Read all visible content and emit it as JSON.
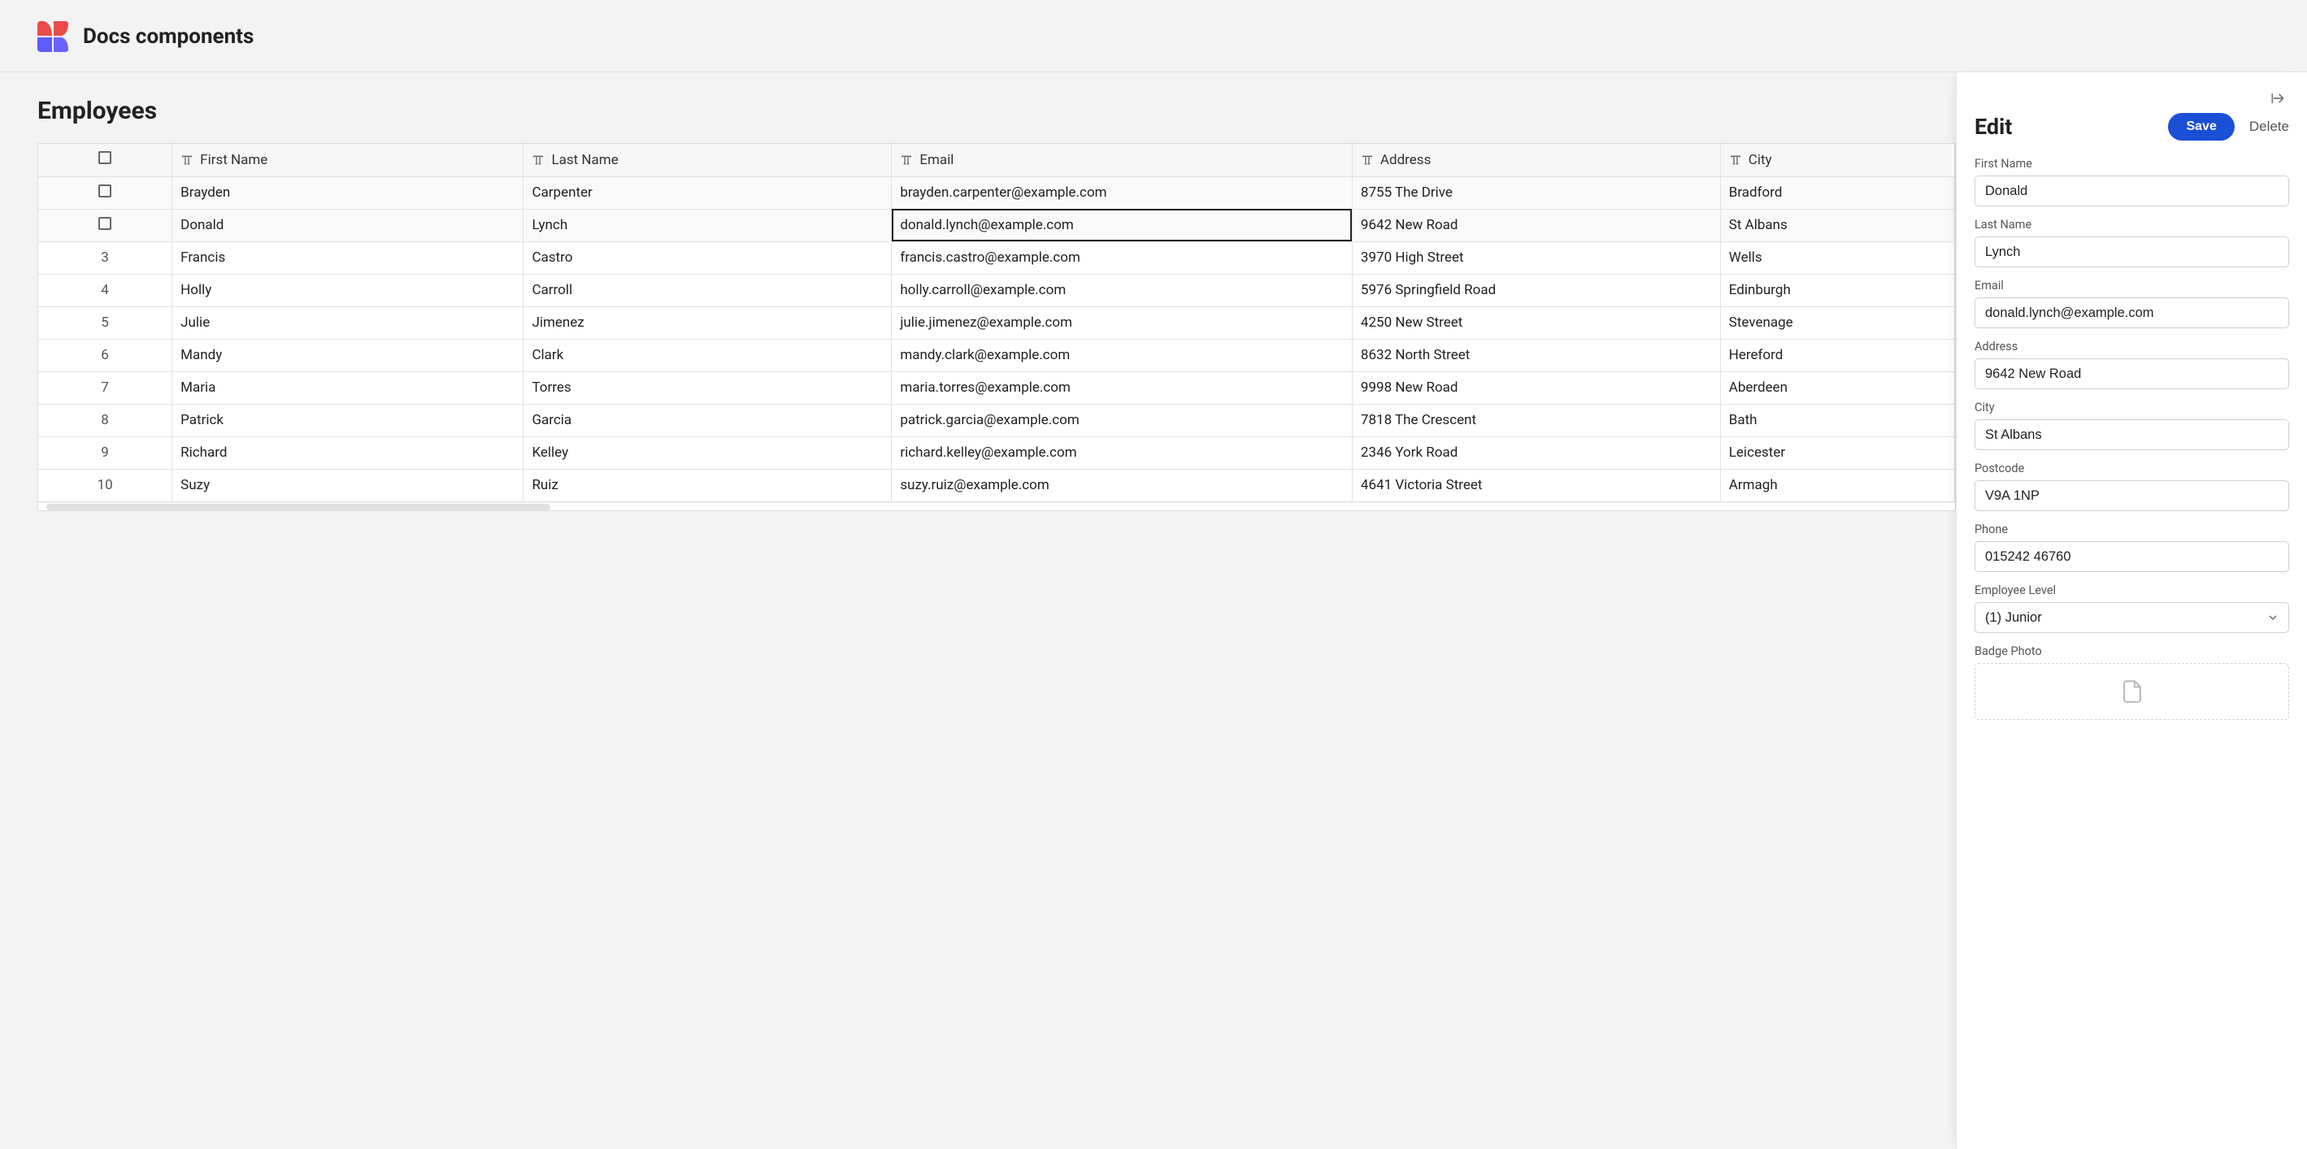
{
  "app": {
    "title": "Docs components"
  },
  "page": {
    "title": "Employees"
  },
  "grid": {
    "columns": [
      {
        "key": "first_name",
        "label": "First Name"
      },
      {
        "key": "last_name",
        "label": "Last Name"
      },
      {
        "key": "email",
        "label": "Email"
      },
      {
        "key": "address",
        "label": "Address"
      },
      {
        "key": "city",
        "label": "City"
      }
    ],
    "selected_rows": [
      0,
      1
    ],
    "focused_cell": {
      "row": 1,
      "col": "email"
    },
    "rows": [
      {
        "num": "",
        "first_name": "Brayden",
        "last_name": "Carpenter",
        "email": "brayden.carpenter@example.com",
        "address": "8755 The Drive",
        "city": "Bradford"
      },
      {
        "num": "",
        "first_name": "Donald",
        "last_name": "Lynch",
        "email": "donald.lynch@example.com",
        "address": "9642 New Road",
        "city": "St Albans"
      },
      {
        "num": "3",
        "first_name": "Francis",
        "last_name": "Castro",
        "email": "francis.castro@example.com",
        "address": "3970 High Street",
        "city": "Wells"
      },
      {
        "num": "4",
        "first_name": "Holly",
        "last_name": "Carroll",
        "email": "holly.carroll@example.com",
        "address": "5976 Springfield Road",
        "city": "Edinburgh"
      },
      {
        "num": "5",
        "first_name": "Julie",
        "last_name": "Jimenez",
        "email": "julie.jimenez@example.com",
        "address": "4250 New Street",
        "city": "Stevenage"
      },
      {
        "num": "6",
        "first_name": "Mandy",
        "last_name": "Clark",
        "email": "mandy.clark@example.com",
        "address": "8632 North Street",
        "city": "Hereford"
      },
      {
        "num": "7",
        "first_name": "Maria",
        "last_name": "Torres",
        "email": "maria.torres@example.com",
        "address": "9998 New Road",
        "city": "Aberdeen"
      },
      {
        "num": "8",
        "first_name": "Patrick",
        "last_name": "Garcia",
        "email": "patrick.garcia@example.com",
        "address": "7818 The Crescent",
        "city": "Bath"
      },
      {
        "num": "9",
        "first_name": "Richard",
        "last_name": "Kelley",
        "email": "richard.kelley@example.com",
        "address": "2346 York Road",
        "city": "Leicester"
      },
      {
        "num": "10",
        "first_name": "Suzy",
        "last_name": "Ruiz",
        "email": "suzy.ruiz@example.com",
        "address": "4641 Victoria Street",
        "city": "Armagh"
      }
    ]
  },
  "panel": {
    "title": "Edit",
    "save_label": "Save",
    "delete_label": "Delete",
    "fields": {
      "first_name": {
        "label": "First Name",
        "value": "Donald"
      },
      "last_name": {
        "label": "Last Name",
        "value": "Lynch"
      },
      "email": {
        "label": "Email",
        "value": "donald.lynch@example.com"
      },
      "address": {
        "label": "Address",
        "value": "9642 New Road"
      },
      "city": {
        "label": "City",
        "value": "St Albans"
      },
      "postcode": {
        "label": "Postcode",
        "value": "V9A 1NP"
      },
      "phone": {
        "label": "Phone",
        "value": "015242 46760"
      },
      "level": {
        "label": "Employee Level",
        "value": "(1) Junior"
      },
      "badge": {
        "label": "Badge Photo"
      }
    }
  }
}
